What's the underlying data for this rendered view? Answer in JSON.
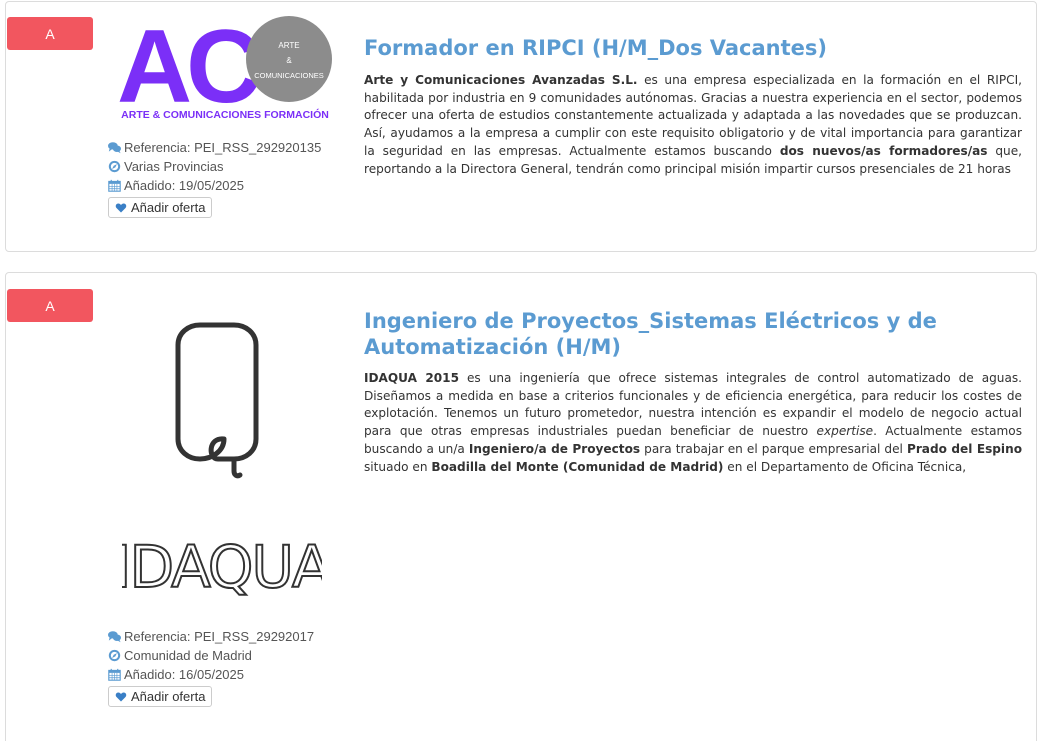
{
  "colors": {
    "badge": "#f2565f",
    "title": "#5b9bd1",
    "logo_purple": "#7b2ff7",
    "logo_gray": "#8c8c8c"
  },
  "offers": [
    {
      "badge": "A",
      "logo": {
        "letters": "AC",
        "circle_lines": [
          "ARTE",
          "&",
          "COMUNICACIONES"
        ],
        "tagline": "ARTE & COMUNICACIONES FORMACIÓN"
      },
      "title": "Formador en RIPCI (H/M_Dos Vacantes)",
      "description": [
        {
          "t": "Arte y Comunicaciones Avanzadas S.L.",
          "b": true
        },
        {
          "t": " es una empresa especializada en la formación en el RIPCI, habilitada por industria en 9 comunidades autónomas. Gracias a nuestra experiencia en el sector, podemos ofrecer una oferta de estudios constantemente actualizada y adaptada a las novedades que se produzcan. Así, ayudamos a la empresa a cumplir con este requisito obligatorio y de vital importancia para garantizar la seguridad en las empresas. Actualmente estamos buscando "
        },
        {
          "t": "dos nuevos/as formadores/as",
          "b": true
        },
        {
          "t": " que, reportando a la Directora General, tendrán como principal misión impartir cursos presenciales de 21 horas"
        }
      ],
      "reference": "Referencia: PEI_RSS_292920135",
      "location": "Varias Provincias",
      "date": "Añadido: 19/05/2025",
      "fav_label": "Añadir oferta"
    },
    {
      "badge": "A",
      "logo": {
        "letters": "IDAQUA"
      },
      "title": "Ingeniero de Proyectos_Sistemas Eléctricos y de Automatización (H/M)",
      "description": [
        {
          "t": "IDAQUA 2015",
          "b": true
        },
        {
          "t": " es una ingeniería que ofrece sistemas integrales de control automatizado de aguas. Diseñamos a medida en base a criterios funcionales y de eficiencia energética, para reducir los costes de explotación. Tenemos un futuro prometedor, nuestra intención es expandir el modelo de negocio actual para que otras empresas industriales puedan beneficiar de nuestro "
        },
        {
          "t": "expertise",
          "i": true
        },
        {
          "t": ". Actualmente estamos buscando a un/a "
        },
        {
          "t": "Ingeniero/a de Proyectos",
          "b": true
        },
        {
          "t": " para trabajar en el parque empresarial del "
        },
        {
          "t": "Prado del Espino",
          "b": true
        },
        {
          "t": " situado en "
        },
        {
          "t": "Boadilla del Monte (Comunidad de Madrid)",
          "b": true
        },
        {
          "t": " en el Departamento de Oficina Técnica,"
        }
      ],
      "reference": "Referencia: PEI_RSS_29292017",
      "location": "Comunidad de Madrid",
      "date": "Añadido: 16/05/2025",
      "fav_label": "Añadir oferta"
    }
  ]
}
